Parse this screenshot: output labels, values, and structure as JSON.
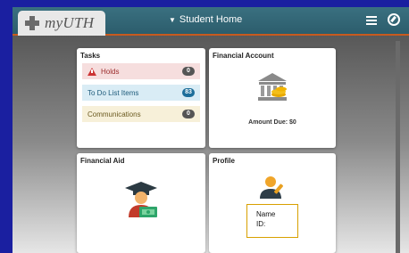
{
  "header": {
    "brand": "myUTH",
    "page_title": "Student Home",
    "title_caret": "▼"
  },
  "tiles": {
    "tasks": {
      "title": "Tasks",
      "rows": [
        {
          "label": "Holds",
          "count": "0"
        },
        {
          "label": "To Do List Items",
          "count": "83"
        },
        {
          "label": "Communications",
          "count": "0"
        }
      ]
    },
    "financial_account": {
      "title": "Financial Account",
      "icon": "bank-icon",
      "amount_due": "Amount Due: $0"
    },
    "financial_aid": {
      "title": "Financial Aid",
      "icon": "graduate-money-icon"
    },
    "profile": {
      "title": "Profile",
      "icon": "person-edit-icon",
      "name_label": "Name",
      "id_label": "ID:"
    }
  },
  "colors": {
    "header": "#2c5d6c",
    "accent": "#c85a1e",
    "page_border": "#1a1fa0"
  }
}
